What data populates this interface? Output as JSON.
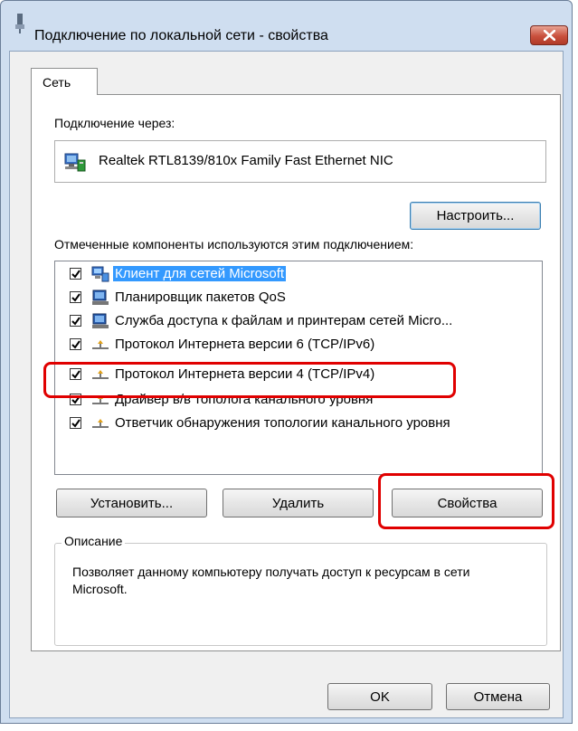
{
  "window": {
    "title": "Подключение по локальной сети - свойства",
    "close_label": "×"
  },
  "tabs": [
    {
      "label": "Сеть"
    }
  ],
  "connection": {
    "label": "Подключение через:",
    "adapter": "Realtek RTL8139/810x Family Fast Ethernet NIC",
    "configure_button": "Настроить..."
  },
  "components": {
    "label": "Отмеченные компоненты используются этим подключением:",
    "items": [
      {
        "label": "Клиент для сетей Microsoft",
        "checked": true,
        "icon": "network-client-icon",
        "selected": true
      },
      {
        "label": "Планировщик пакетов QoS",
        "checked": true,
        "icon": "network-service-icon"
      },
      {
        "label": "Служба доступа к файлам и принтерам сетей Micro...",
        "checked": true,
        "icon": "network-service-icon"
      },
      {
        "label": "Протокол Интернета версии 6 (TCP/IPv6)",
        "checked": true,
        "icon": "protocol-icon"
      },
      {
        "label": "Протокол Интернета версии 4 (TCP/IPv4)",
        "checked": true,
        "icon": "protocol-icon",
        "highlighted": true
      },
      {
        "label": "Драйвер в/в тополога канального уровня",
        "checked": true,
        "icon": "protocol-icon"
      },
      {
        "label": "Ответчик обнаружения топологии канального уровня",
        "checked": true,
        "icon": "protocol-icon"
      }
    ]
  },
  "buttons": {
    "install": "Установить...",
    "uninstall": "Удалить",
    "properties": "Свойства",
    "ok": "OK",
    "cancel": "Отмена"
  },
  "description": {
    "title": "Описание",
    "text": "Позволяет данному компьютеру получать доступ к ресурсам в сети Microsoft."
  },
  "colors": {
    "highlight": "#e00000",
    "selection": "#3399ff",
    "frame": "#cfdef0"
  }
}
